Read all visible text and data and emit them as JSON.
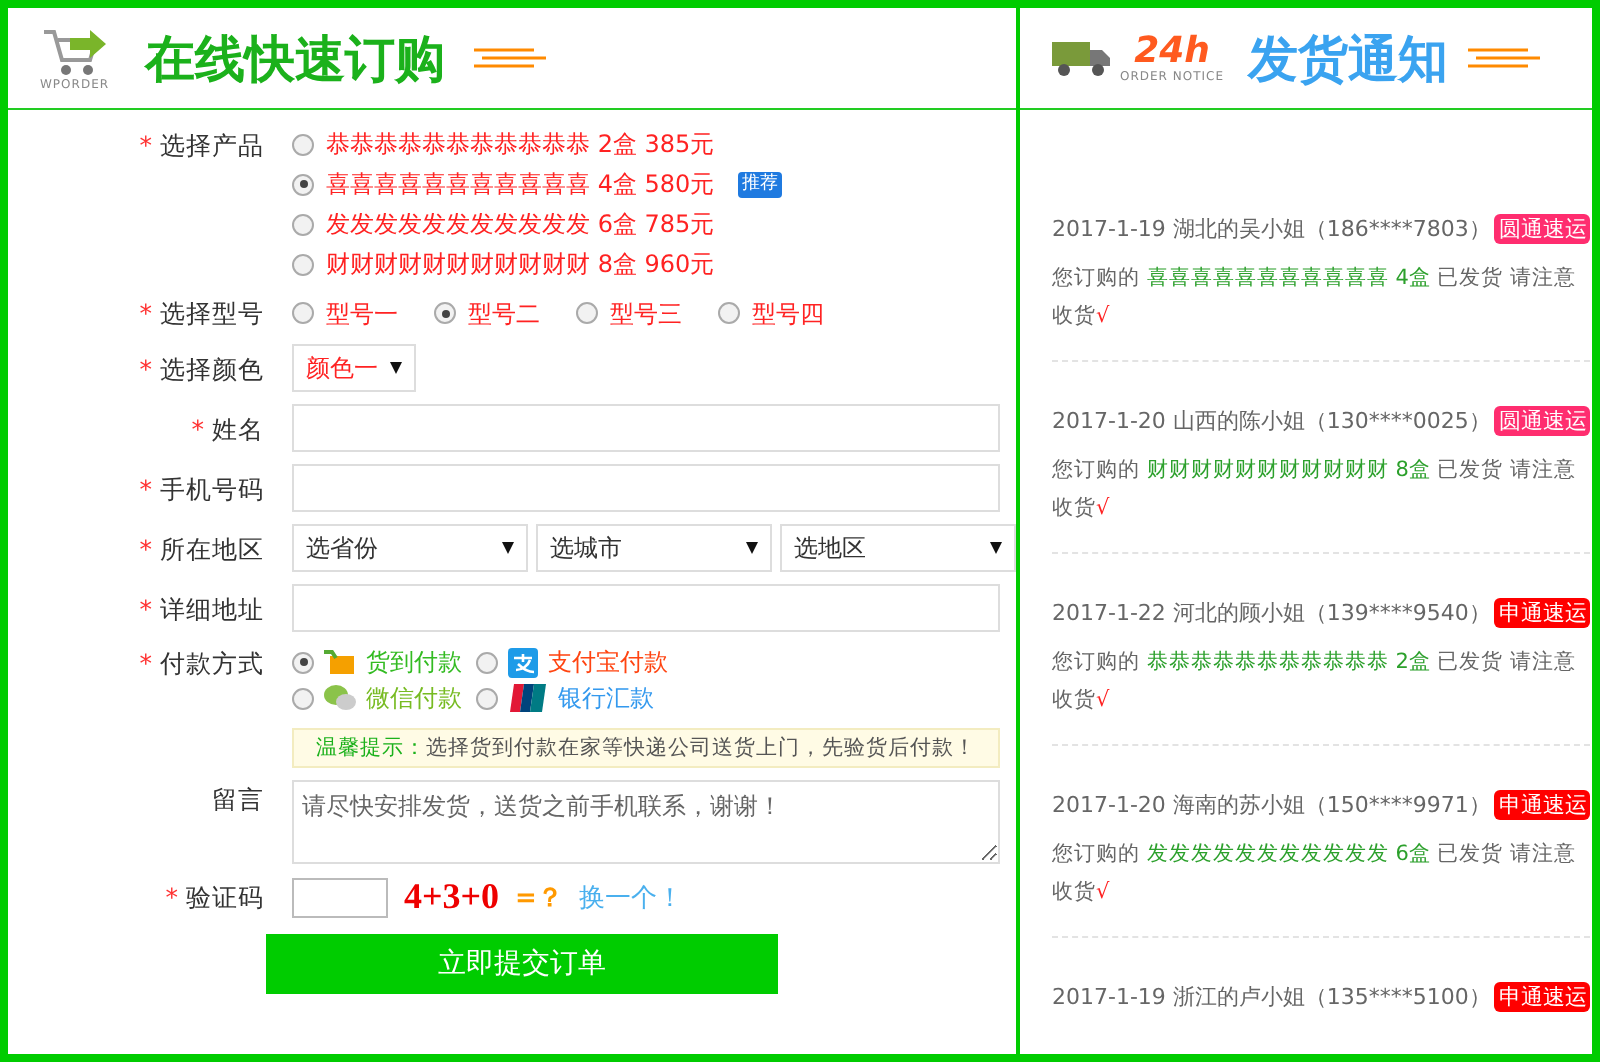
{
  "order_panel": {
    "logo_caption": "WPORDER",
    "title": "在线快速订购",
    "form": {
      "product": {
        "label": "选择产品",
        "mark": "*",
        "options": [
          {
            "name": "恭恭恭恭恭恭恭恭恭恭恭 2盒 385元",
            "selected": false
          },
          {
            "name": "喜喜喜喜喜喜喜喜喜喜喜 4盒 580元",
            "selected": true,
            "badge": "推荐"
          },
          {
            "name": "发发发发发发发发发发发 6盒 785元",
            "selected": false
          },
          {
            "name": "财财财财财财财财财财财 8盒 960元",
            "selected": false
          }
        ]
      },
      "model": {
        "label": "选择型号",
        "mark": "*",
        "options": [
          {
            "name": "型号一",
            "selected": false
          },
          {
            "name": "型号二",
            "selected": true
          },
          {
            "name": "型号三",
            "selected": false
          },
          {
            "name": "型号四",
            "selected": false
          }
        ]
      },
      "color": {
        "label": "选择颜色",
        "mark": "*",
        "value": "颜色一"
      },
      "name": {
        "label": "姓名",
        "mark": "*"
      },
      "phone": {
        "label": "手机号码",
        "mark": "*"
      },
      "region": {
        "label": "所在地区",
        "mark": "*",
        "selects": [
          "选省份",
          "选城市",
          "选地区"
        ]
      },
      "address": {
        "label": "详细地址",
        "mark": "*"
      },
      "payment": {
        "label": "付款方式",
        "mark": "*",
        "options": [
          {
            "kind": "cod",
            "name": "货到付款",
            "selected": true,
            "color": "#33bb22"
          },
          {
            "kind": "alipay",
            "name": "支付宝付款",
            "selected": false,
            "color": "#ff4411"
          },
          {
            "kind": "wechat",
            "name": "微信付款",
            "selected": false,
            "color": "#77bb22"
          },
          {
            "kind": "bank",
            "name": "银行汇款",
            "selected": false,
            "color": "#3399ee"
          }
        ]
      },
      "tip": {
        "label": "温馨提示：",
        "text": "选择货到付款在家等快递公司送货上门，先验货后付款！"
      },
      "message": {
        "label": "留言",
        "value": "请尽快安排发货，送货之前手机联系，谢谢！"
      },
      "captcha": {
        "label": "验证码",
        "mark": "*",
        "question": "4+3+0",
        "equals": "=？",
        "refresh": "换一个！"
      },
      "submit": "立即提交订单"
    }
  },
  "notice_panel": {
    "badge_text": "24h",
    "logo_caption": "ORDER NOTICE",
    "title": "发货通知",
    "notices": [
      {
        "info": "2017-1-19 湖北的吴小姐（186****7803）",
        "courier": "圆通速运",
        "color": "#ff2d6f",
        "prefix": "您订购的",
        "product": "喜喜喜喜喜喜喜喜喜喜喜",
        "qty": "4盒",
        "suffix": "已发货 请注意收货",
        "mark": "√"
      },
      {
        "info": "2017-1-20 山西的陈小姐（130****0025）",
        "courier": "圆通速运",
        "color": "#ff2d6f",
        "prefix": "您订购的",
        "product": "财财财财财财财财财财财",
        "qty": "8盒",
        "suffix": "已发货 请注意收货",
        "mark": "√"
      },
      {
        "info": "2017-1-22 河北的顾小姐（139****9540）",
        "courier": "申通速运",
        "color": "#ff0000",
        "prefix": "您订购的",
        "product": "恭恭恭恭恭恭恭恭恭恭恭",
        "qty": "2盒",
        "suffix": "已发货 请注意收货",
        "mark": "√"
      },
      {
        "info": "2017-1-20 海南的苏小姐（150****9971）",
        "courier": "申通速运",
        "color": "#ff0000",
        "prefix": "您订购的",
        "product": "发发发发发发发发发发发",
        "qty": "6盒",
        "suffix": "已发货 请注意收货",
        "mark": "√"
      },
      {
        "info": "2017-1-19 浙江的卢小姐（135****5100）",
        "courier": "申通速运",
        "color": "#ff0000"
      }
    ]
  }
}
